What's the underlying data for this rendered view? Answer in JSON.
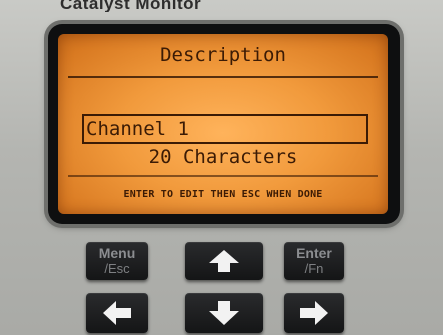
{
  "device": {
    "title": "Catalyst Monitor"
  },
  "lcd": {
    "heading": "Description",
    "field_value": "Channel 1",
    "char_limit_text": "20 Characters",
    "instructions": "ENTER TO EDIT THEN ESC WHEN DONE",
    "backlight_color": "#f19a3c",
    "text_color": "#3b1b05"
  },
  "keypad": {
    "menu_top": "Menu",
    "menu_bottom": "/Esc",
    "enter_top": "Enter",
    "enter_bottom": "/Fn",
    "up_icon": "arrow-up-icon",
    "down_icon": "arrow-down-icon",
    "left_icon": "arrow-left-icon",
    "right_icon": "arrow-right-icon"
  }
}
